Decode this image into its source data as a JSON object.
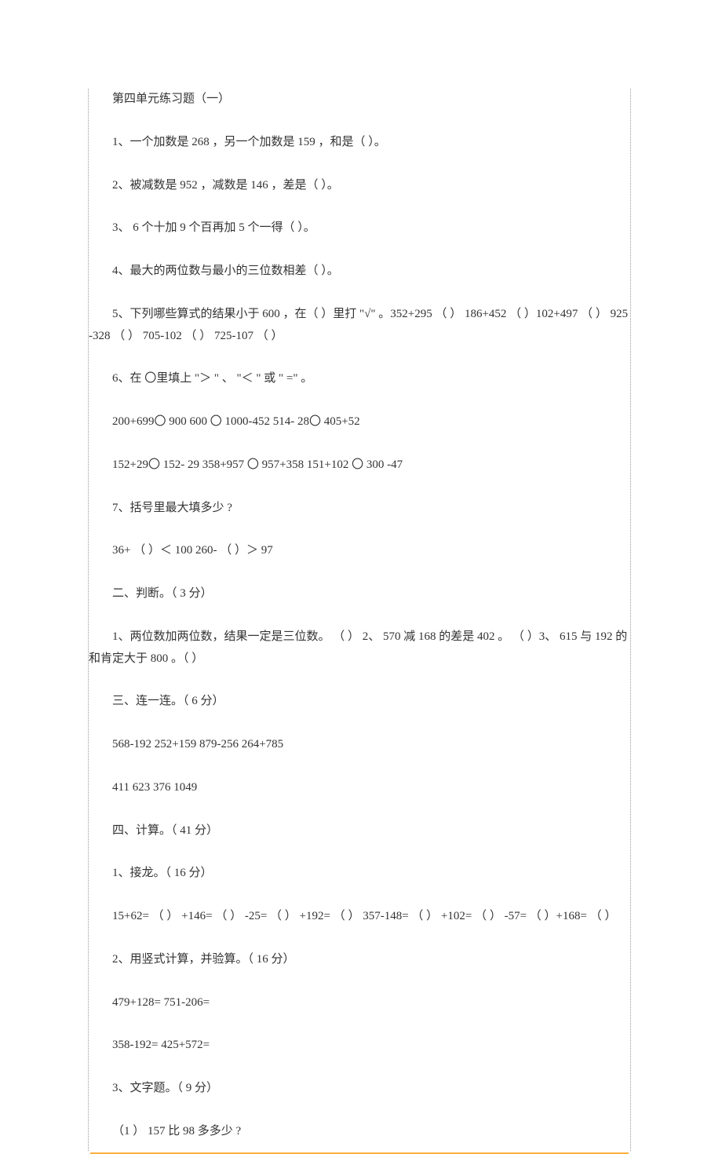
{
  "title": "第四单元练习题（一）",
  "lines": {
    "q1": "1、一个加数是   268 ，另一个加数是   159 ，和是（  ）。",
    "q2": "2、被减数是   952 ，减数是   146 ，差是（  ）。",
    "q3": "3、 6 个十加  9 个百再加  5 个一得（  ）。",
    "q4": "4、最大的两位数与最小的三位数相差（     ）。",
    "q5": "5、下列哪些算式的结果小于     600 ，在（  ）里打 \"√\" 。352+295 （  ） 186+452 （  ）102+497 （  ） 925-328 （  ） 705-102 （  ） 725-107 （  ）",
    "q6": "6、在 〇里填上 \"＞ \" 、 \"＜ \" 或  \" =\" 。",
    "q6a": "200+699〇 900 600 〇 1000-452 514- 28〇 405+52",
    "q6b": "152+29〇 152- 29 358+957 〇 957+358 151+102 〇 300 -47",
    "q7": "7、括号里最大填多少 ?",
    "q7a": "36+ （  ）＜ 100 260- （  ）＞ 97",
    "sec2": "二、判断。（  3 分）",
    "sec2q1": "1、两位数加两位数，结果一定是三位数。    （   ） 2、  570 减 168 的差是   402  。 （  ）3、 615 与 192 的和肯定大于    800 。（  ）",
    "sec3": "三、连一连。（  6 分）",
    "sec3a": "568-192 252+159 879-256 264+785",
    "sec3b": "411 623 376 1049",
    "sec4": "四、计算。（  41 分）",
    "sec4q1": "1、接龙。（  16 分）",
    "sec4q1a": "15+62= （  ） +146= （  ） -25= （  ） +192= （  ） 357-148= （  ） +102= （  ） -57= （  ）+168= （  ）",
    "sec4q2": "2、用竖式计算，并验算。（   16 分）",
    "sec4q2a": "479+128= 751-206=",
    "sec4q2b": "358-192= 425+572=",
    "sec4q3": "3、文字题。（  9 分）",
    "sec4q3a": "（1 ） 157 比 98 多多少 ?"
  }
}
